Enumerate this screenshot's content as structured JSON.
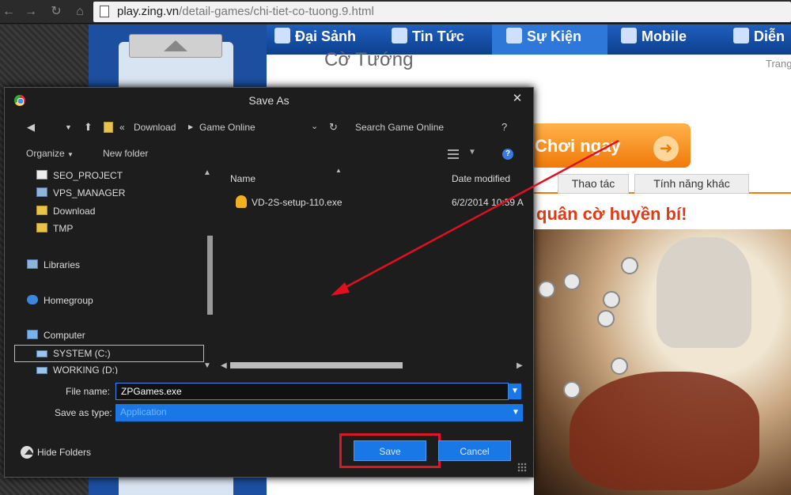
{
  "browser": {
    "url_host": "play.zing.vn",
    "url_path": "/detail-games/chi-tiet-co-tuong.9.html"
  },
  "site": {
    "nav": [
      "Đại Sảnh",
      "Tin Tức",
      "Sự Kiện",
      "Mobile",
      "Diễn"
    ],
    "title": "Cờ Tướng",
    "trang": "Trang",
    "play_button": "Chơi ngay",
    "tabs": [
      "Thao tác",
      "Tính năng khác"
    ],
    "headline": "quân cờ huyền bí!"
  },
  "dialog": {
    "title": "Save As",
    "path": [
      "Download",
      "Game Online"
    ],
    "search_placeholder": "Search Game Online",
    "help": "?",
    "organize": "Organize",
    "new_folder": "New folder",
    "nav_items": [
      {
        "label": "SEO_PROJECT",
        "icon": "folder-white-icon"
      },
      {
        "label": "VPS_MANAGER",
        "icon": "network-folder-icon"
      },
      {
        "label": "Download",
        "icon": "folder-icon"
      },
      {
        "label": "TMP",
        "icon": "folder-icon"
      },
      {
        "label": "Libraries",
        "icon": "libraries-icon"
      },
      {
        "label": "Homegroup",
        "icon": "homegroup-icon"
      },
      {
        "label": "Computer",
        "icon": "computer-icon"
      },
      {
        "label": "SYSTEM (C:)",
        "icon": "drive-icon"
      },
      {
        "label": "WORKING (D:)",
        "icon": "drive-icon"
      }
    ],
    "columns": {
      "name": "Name",
      "date_modified": "Date modified"
    },
    "files": [
      {
        "name": "VD-2S-setup-110.exe",
        "date": "6/2/2014 10:59 A"
      }
    ],
    "file_name_label": "File name:",
    "file_name_value": "ZPGames.exe",
    "save_type_label": "Save as type:",
    "save_type_value": "Application",
    "hide_folders": "Hide Folders",
    "save_button": "Save",
    "cancel_button": "Cancel"
  },
  "colors": {
    "dialog_bg": "#1d1d1d",
    "accent_blue": "#1a78e6",
    "highlight_red": "#d8182a"
  }
}
